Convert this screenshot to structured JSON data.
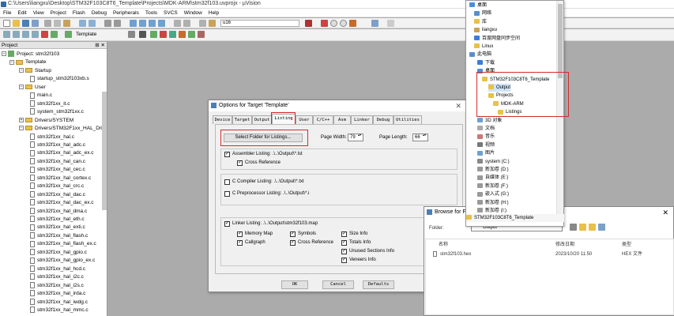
{
  "window": {
    "title": "C:\\Users\\liangxu\\Desktop\\STM32F103C8T6_Template\\Projects\\MDK-ARM\\stm32f103.uvprojx - µVision"
  },
  "menu": [
    "File",
    "Edit",
    "View",
    "Project",
    "Flash",
    "Debug",
    "Peripherals",
    "Tools",
    "SVCS",
    "Window",
    "Help"
  ],
  "toolbar": {
    "target_name": "Template",
    "find_text": "u16"
  },
  "project": {
    "header": "Project",
    "header_icons": "⊞ ✕",
    "root": "Project: stm32f103",
    "target": "Template",
    "groups": [
      {
        "name": "Startup",
        "files": [
          "startup_stm32f103xb.s"
        ]
      },
      {
        "name": "User",
        "files": [
          "main.c",
          "stm32f1xx_it.c",
          "system_stm32f1xx.c"
        ]
      },
      {
        "name": "Drivers/SYSTEM",
        "files": []
      },
      {
        "name": "Drivers/STM32F1xx_HAL_Driv",
        "files": [
          "stm32f1xx_hal.c",
          "stm32f1xx_hal_adc.c",
          "stm32f1xx_hal_adc_ex.c",
          "stm32f1xx_hal_can.c",
          "stm32f1xx_hal_cec.c",
          "stm32f1xx_hal_cortex.c",
          "stm32f1xx_hal_crc.c",
          "stm32f1xx_hal_dac.c",
          "stm32f1xx_hal_dac_ex.c",
          "stm32f1xx_hal_dma.c",
          "stm32f1xx_hal_eth.c",
          "stm32f1xx_hal_exti.c",
          "stm32f1xx_hal_flash.c",
          "stm32f1xx_hal_flash_ex.c",
          "stm32f1xx_hal_gpio.c",
          "stm32f1xx_hal_gpio_ex.c",
          "stm32f1xx_hal_hcd.c",
          "stm32f1xx_hal_i2c.c",
          "stm32f1xx_hal_i2s.c",
          "stm32f1xx_hal_irda.c",
          "stm32f1xx_hal_iwdg.c",
          "stm32f1xx_hal_mmc.c"
        ]
      }
    ]
  },
  "options_dialog": {
    "title": "Options for Target 'Template'",
    "close": "✕",
    "tabs": [
      "Device",
      "Target",
      "Output",
      "Listing",
      "User",
      "C/C++",
      "Asm",
      "Linker",
      "Debug",
      "Utilities"
    ],
    "active_tab": "Listing",
    "select_folder_button": "Select Folder for Listings...",
    "page_width_label": "Page Width:",
    "page_width_value": "79",
    "page_length_label": "Page Length:",
    "page_length_value": "66",
    "assembler_listing": "Assembler Listing:  .\\..\\Output\\*.lst",
    "cross_reference": "Cross Reference",
    "c_compiler_listing": "C Compiler Listing:  .\\..\\Output\\*.txt",
    "c_preprocessor_listing": "C Preprocessor Listing:  .\\..\\Output\\*.i",
    "linker_listing": "Linker Listing:  .\\..\\Output\\stm32f103.map",
    "linker_options": {
      "memory_map": "Memory Map",
      "callgraph": "Callgraph",
      "symbols": "Symbols",
      "cross_reference": "Cross Reference",
      "size_info": "Size Info",
      "totals_info": "Totals Info",
      "unused_sections_info": "Unused Sections Info",
      "veneers_info": "Veneers Info"
    },
    "check": "✓",
    "ok": "OK",
    "cancel": "Cancel",
    "defaults": "Defaults"
  },
  "explorer": {
    "items": [
      "桌面",
      "网络",
      "库",
      "liangxu",
      "百度网盘同步空间",
      "Linux",
      "此电脑",
      "下载",
      "桌面",
      "STM32F103C8T6_Template",
      "Output",
      "Projects",
      "MDK-ARM",
      "Listings",
      "3D 对象",
      "文档",
      "音乐",
      "视频",
      "图片",
      "system (C:)",
      "新加卷 (D:)",
      "自媒体 (E:)",
      "新加卷 (F:)",
      "嵌入式 (G:)",
      "新加卷 (H:)",
      "新加卷 (I:)",
      "STM32F103C8T6_Template"
    ]
  },
  "browse_dialog": {
    "title": "Browse for F",
    "close": "✕",
    "folder_label": "Folder:",
    "folder_value": "Output",
    "col_name": "名称",
    "col_modified": "修改日期",
    "col_type": "类型",
    "file_name": "stm32f103.hex",
    "file_date": "2023/10/20 11:50",
    "file_type": "HEX 文件"
  },
  "colors": {
    "highlight_red": "#d42b2b",
    "folder_yellow": "#e9c04a",
    "selection_blue": "#cfe4fb"
  }
}
